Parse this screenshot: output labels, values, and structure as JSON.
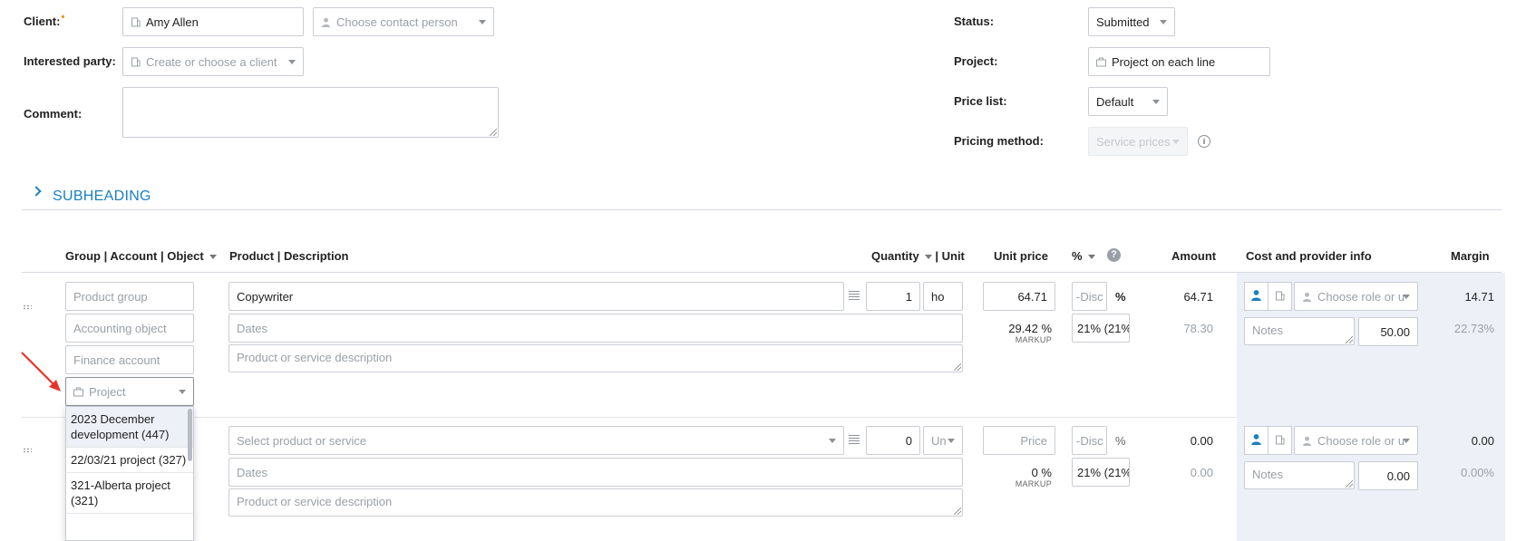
{
  "header": {
    "client_label": "Client:",
    "client_required_mark": "•",
    "client_value": "Amy Allen",
    "contact_placeholder": "Choose contact person",
    "interested_label": "Interested party:",
    "interested_placeholder": "Create or choose a client",
    "comment_label": "Comment:",
    "status_label": "Status:",
    "status_value": "Submitted",
    "project_label": "Project:",
    "project_value": "Project on each line",
    "pricelist_label": "Price list:",
    "pricelist_value": "Default",
    "pricing_label": "Pricing method:",
    "pricing_value": "Service prices"
  },
  "subheading": "SUBHEADING",
  "table": {
    "col_group": "Group | Account | Object",
    "col_product": "Product | Description",
    "col_quantity": "Quantity",
    "col_unit": "| Unit",
    "col_unit_price": "Unit price",
    "col_percent": "%",
    "col_amount": "Amount",
    "col_cost": "Cost and provider info",
    "col_margin": "Margin"
  },
  "rows": [
    {
      "product_group": "Product group",
      "accounting_object": "Accounting object",
      "finance_account": "Finance account",
      "project_placeholder": "Project",
      "product": "Copywriter",
      "dates": "Dates",
      "description": "Product or service description",
      "quantity": "1",
      "unit": "ho",
      "unit_price": "64.71",
      "markup": "29.42 %",
      "markup_label": "MARKUP",
      "discount": "-Disc",
      "pct_sign": "%",
      "tax": "21% (21%",
      "amount": "64.71",
      "amount_tax": "78.30",
      "role_placeholder": "Choose role or u",
      "notes": "Notes",
      "cost": "50.00",
      "margin": "14.71",
      "margin_pct": "22.73%"
    },
    {
      "product": "Select product or service",
      "dates": "Dates",
      "description": "Product or service description",
      "quantity": "0",
      "unit": "Un",
      "unit_price": "Price",
      "markup": "0 %",
      "markup_label": "MARKUP",
      "discount": "-Disc",
      "pct_sign": "%",
      "tax": "21% (21%",
      "amount": "0.00",
      "amount_tax": "0.00",
      "role_placeholder": "Choose role or u",
      "notes": "Notes",
      "cost": "0.00",
      "margin": "0.00",
      "margin_pct": "0.00%"
    }
  ],
  "project_dropdown": [
    "2023 December development (447)",
    "22/03/21 project (327)",
    "321-Alberta project (321)"
  ],
  "colors": {
    "accent": "#1a7fc1",
    "panel": "#eef0f7",
    "arrow": "#e8332a"
  }
}
